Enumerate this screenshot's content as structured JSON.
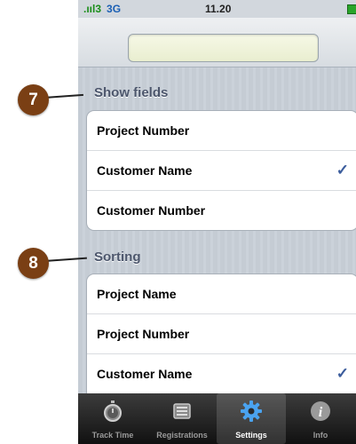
{
  "status_bar": {
    "signal": ".ııl",
    "carrier": "3",
    "network": "3G",
    "time": "11.20"
  },
  "sections": [
    {
      "header": "Show fields",
      "rows": [
        {
          "label": "Project Number",
          "checked": false
        },
        {
          "label": "Customer Name",
          "checked": true
        },
        {
          "label": "Customer Number",
          "checked": false
        }
      ]
    },
    {
      "header": "Sorting",
      "rows": [
        {
          "label": "Project Name",
          "checked": false
        },
        {
          "label": "Project Number",
          "checked": false
        },
        {
          "label": "Customer Name",
          "checked": true
        }
      ]
    }
  ],
  "checkmark": "✓",
  "tabs": [
    {
      "label": "Track Time",
      "icon": "stopwatch-icon",
      "active": false
    },
    {
      "label": "Registrations",
      "icon": "tray-icon",
      "active": false
    },
    {
      "label": "Settings",
      "icon": "gear-icon",
      "active": true
    },
    {
      "label": "Info",
      "icon": "info-icon",
      "active": false
    }
  ],
  "callouts": [
    "7",
    "8"
  ],
  "colors": {
    "callout": "#7a3f14",
    "check": "#3b5c9c",
    "section_header": "#4c566c",
    "tab_bar": "#1e1e1e"
  }
}
